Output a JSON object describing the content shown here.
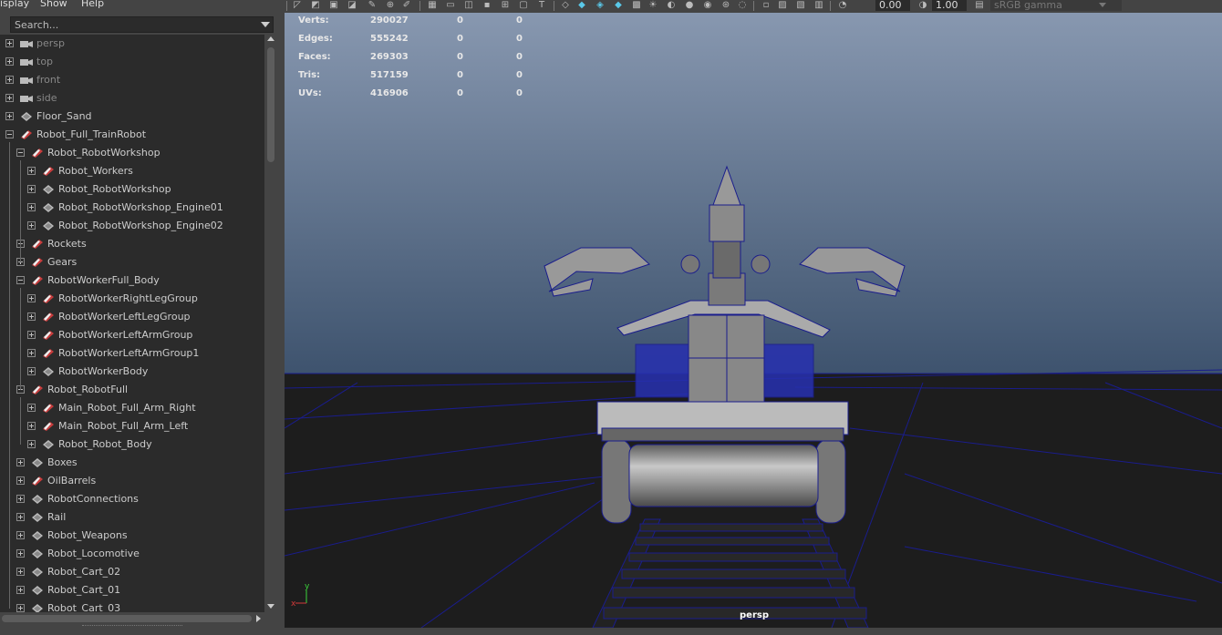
{
  "outliner": {
    "menu": [
      "isplay",
      "Show",
      "Help"
    ],
    "search_placeholder": "Search...",
    "items": [
      {
        "label": "persp",
        "type": "camera",
        "depth": 0
      },
      {
        "label": "top",
        "type": "camera",
        "depth": 0
      },
      {
        "label": "front",
        "type": "camera",
        "depth": 0
      },
      {
        "label": "side",
        "type": "camera",
        "depth": 0
      },
      {
        "label": "Floor_Sand",
        "type": "transform",
        "depth": 0
      },
      {
        "label": "Robot_Full_TrainRobot",
        "type": "set",
        "depth": 0,
        "expanded": true
      },
      {
        "label": "Robot_RobotWorkshop",
        "type": "set",
        "depth": 1,
        "expanded": true
      },
      {
        "label": "Robot_Workers",
        "type": "set",
        "depth": 2
      },
      {
        "label": "Robot_RobotWorkshop",
        "type": "transform",
        "depth": 2
      },
      {
        "label": "Robot_RobotWorkshop_Engine01",
        "type": "transform",
        "depth": 2
      },
      {
        "label": "Robot_RobotWorkshop_Engine02",
        "type": "transform",
        "depth": 2
      },
      {
        "label": "Rockets",
        "type": "set",
        "depth": 1
      },
      {
        "label": "Gears",
        "type": "set",
        "depth": 1
      },
      {
        "label": "RobotWorkerFull_Body",
        "type": "set",
        "depth": 1,
        "expanded": true
      },
      {
        "label": "RobotWorkerRightLegGroup",
        "type": "set",
        "depth": 2
      },
      {
        "label": "RobotWorkerLeftLegGroup",
        "type": "set",
        "depth": 2
      },
      {
        "label": "RobotWorkerLeftArmGroup",
        "type": "set",
        "depth": 2
      },
      {
        "label": "RobotWorkerLeftArmGroup1",
        "type": "set",
        "depth": 2
      },
      {
        "label": "RobotWorkerBody",
        "type": "transform",
        "depth": 2
      },
      {
        "label": "Robot_RobotFull",
        "type": "set",
        "depth": 1,
        "expanded": true
      },
      {
        "label": "Main_Robot_Full_Arm_Right",
        "type": "set",
        "depth": 2
      },
      {
        "label": "Main_Robot_Full_Arm_Left",
        "type": "set",
        "depth": 2
      },
      {
        "label": "Robot_Robot_Body",
        "type": "transform",
        "depth": 2
      },
      {
        "label": "Boxes",
        "type": "transform",
        "depth": 1
      },
      {
        "label": "OilBarrels",
        "type": "set",
        "depth": 1
      },
      {
        "label": "RobotConnections",
        "type": "transform",
        "depth": 1
      },
      {
        "label": "Rail",
        "type": "transform",
        "depth": 1
      },
      {
        "label": "Robot_Weapons",
        "type": "transform",
        "depth": 1
      },
      {
        "label": "Robot_Locomotive",
        "type": "transform",
        "depth": 1
      },
      {
        "label": "Robot_Cart_02",
        "type": "transform",
        "depth": 1
      },
      {
        "label": "Robot_Cart_01",
        "type": "transform",
        "depth": 1
      },
      {
        "label": "Robot_Cart_03",
        "type": "transform",
        "depth": 1
      }
    ]
  },
  "toolbar": {
    "exposure": "0.00",
    "gamma": "1.00",
    "color_space": "sRGB gamma"
  },
  "hud": {
    "rows": [
      {
        "label": "Verts:",
        "total": "290027",
        "selected": "0",
        "components": "0"
      },
      {
        "label": "Edges:",
        "total": "555242",
        "selected": "0",
        "components": "0"
      },
      {
        "label": "Faces:",
        "total": "269303",
        "selected": "0",
        "components": "0"
      },
      {
        "label": "Tris:",
        "total": "517159",
        "selected": "0",
        "components": "0"
      },
      {
        "label": "UVs:",
        "total": "416906",
        "selected": "0",
        "components": "0"
      }
    ],
    "camera": "persp",
    "axis_y": "y",
    "axis_x": "x"
  },
  "colors": {
    "sky_top": "#8a9ab2",
    "sky_bottom": "#3e536e",
    "ground": "#1d1d1d",
    "wireframe": "#1a1d8c",
    "model_fill": "#6f6f6f",
    "icon_set": "#c83c3c"
  }
}
